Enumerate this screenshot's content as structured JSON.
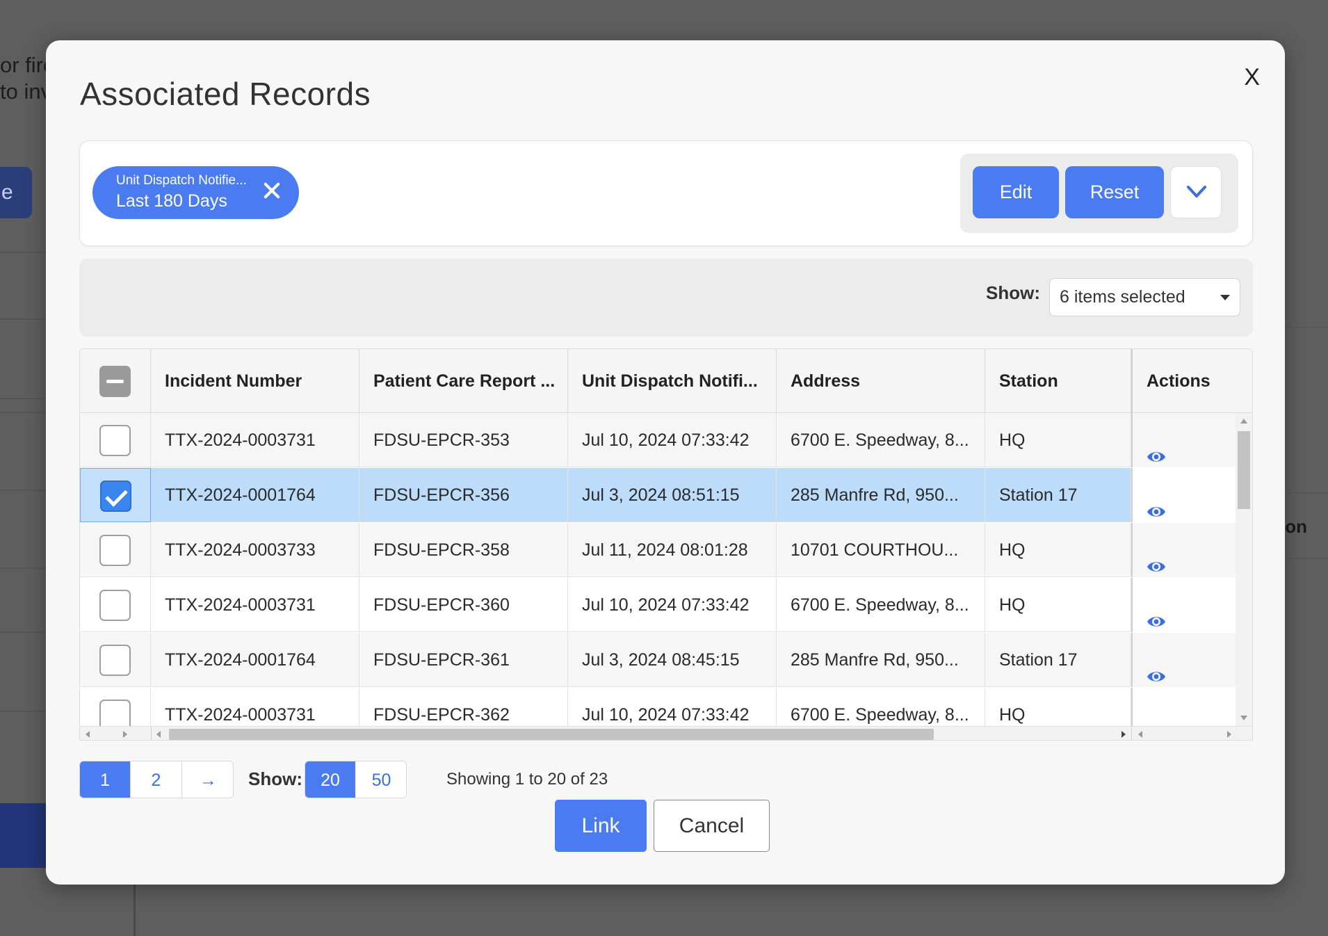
{
  "background": {
    "line1": "or fire",
    "line2": "to inv",
    "button_fragment": "e",
    "right_fragment": "on"
  },
  "modal": {
    "title": "Associated Records",
    "close_label": "X"
  },
  "filter": {
    "chip_field": "Unit Dispatch Notifie...",
    "chip_value": "Last 180 Days",
    "edit_label": "Edit",
    "reset_label": "Reset"
  },
  "columns_control": {
    "label": "Show:",
    "value": "6 items selected"
  },
  "table": {
    "headers": {
      "incident": "Incident Number",
      "pcr": "Patient Care Report ...",
      "dispatch": "Unit Dispatch Notifi...",
      "address": "Address",
      "station": "Station",
      "actions": "Actions"
    },
    "rows": [
      {
        "incident": "TTX-2024-0003731",
        "pcr": "FDSU-EPCR-353",
        "dispatch": "Jul 10, 2024 07:33:42",
        "address": "6700 E. Speedway, 8...",
        "station": "HQ",
        "selected": false
      },
      {
        "incident": "TTX-2024-0001764",
        "pcr": "FDSU-EPCR-356",
        "dispatch": "Jul 3, 2024 08:51:15",
        "address": "285 Manfre Rd, 950...",
        "station": "Station 17",
        "selected": true
      },
      {
        "incident": "TTX-2024-0003733",
        "pcr": "FDSU-EPCR-358",
        "dispatch": "Jul 11, 2024 08:01:28",
        "address": "10701 COURTHOU...",
        "station": "HQ",
        "selected": false
      },
      {
        "incident": "TTX-2024-0003731",
        "pcr": "FDSU-EPCR-360",
        "dispatch": "Jul 10, 2024 07:33:42",
        "address": "6700 E. Speedway, 8...",
        "station": "HQ",
        "selected": false
      },
      {
        "incident": "TTX-2024-0001764",
        "pcr": "FDSU-EPCR-361",
        "dispatch": "Jul 3, 2024 08:45:15",
        "address": "285 Manfre Rd, 950...",
        "station": "Station 17",
        "selected": false
      },
      {
        "incident": "TTX-2024-0003731",
        "pcr": "FDSU-EPCR-362",
        "dispatch": "Jul 10, 2024 07:33:42",
        "address": "6700 E. Speedway, 8...",
        "station": "HQ",
        "selected": false
      }
    ],
    "row_action_icon": "eye-icon"
  },
  "pagination": {
    "pages": [
      "1",
      "2"
    ],
    "next_label": "→",
    "show_label": "Show:",
    "page_sizes": [
      "20",
      "50"
    ],
    "summary": "Showing 1 to 20 of 23"
  },
  "footer": {
    "link_label": "Link",
    "cancel_label": "Cancel"
  },
  "colors": {
    "accent": "#4a7bf0",
    "selected_row": "#bcdcf9",
    "overlay": "#5e5e5e"
  }
}
